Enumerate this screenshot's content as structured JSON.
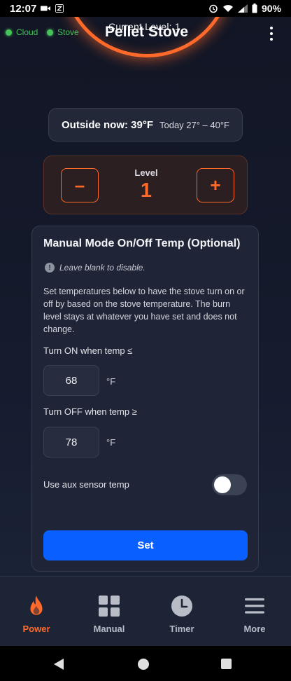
{
  "status_bar": {
    "time": "12:07",
    "battery": "90%"
  },
  "header": {
    "cloud_label": "Cloud",
    "stove_label": "Stove",
    "current_level_text": "Current Level: 1",
    "title": "Pellet Stove"
  },
  "weather": {
    "outside_now": "Outside now: 39°F",
    "today_range": "Today 27° – 40°F"
  },
  "level": {
    "minus_label": "–",
    "label": "Level",
    "value": "1",
    "plus_label": "+"
  },
  "manual_mode": {
    "title": "Manual Mode On/Off Temp (Optional)",
    "hint": "Leave blank to disable.",
    "description": "Set temperatures below to have the stove turn on or off by based on the stove temperature. The burn level stays at whatever you have set and does not change.",
    "on_label": "Turn ON when temp ≤",
    "on_value": "68",
    "off_label": "Turn OFF when temp ≥",
    "off_value": "78",
    "unit": "°F",
    "aux_label": "Use aux sensor temp",
    "aux_enabled": false,
    "set_label": "Set"
  },
  "bottom_nav": {
    "items": [
      {
        "label": "Power",
        "icon": "flame-icon",
        "active": true
      },
      {
        "label": "Manual",
        "icon": "grid-icon",
        "active": false
      },
      {
        "label": "Timer",
        "icon": "clock-icon",
        "active": false
      },
      {
        "label": "More",
        "icon": "menu-icon",
        "active": false
      }
    ]
  },
  "colors": {
    "accent": "#ff6a2b",
    "primary_button": "#0a60ff",
    "connected": "#45c25a"
  }
}
